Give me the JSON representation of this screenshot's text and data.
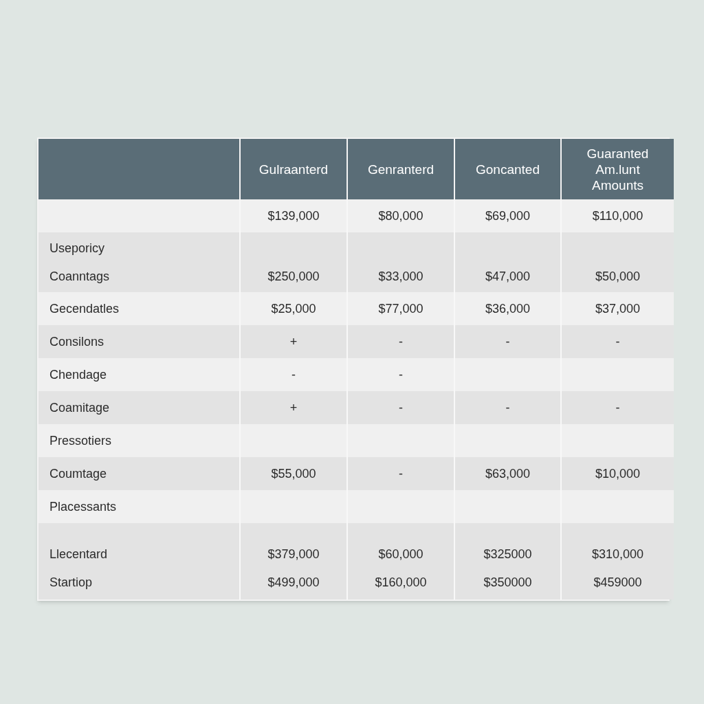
{
  "table": {
    "columns": [
      {},
      {
        "lines": [
          "Gulraanterd"
        ]
      },
      {
        "lines": [
          "Genranterd"
        ]
      },
      {
        "lines": [
          "Goncanted"
        ]
      },
      {
        "lines": [
          "Guaranted",
          "Am.lunt",
          "Amounts"
        ]
      }
    ],
    "rows": [
      {
        "lines": [
          {
            "values": [
              "$139,000",
              "$80,000",
              "$69,000",
              "$110,000"
            ]
          }
        ]
      },
      {
        "lines": [
          {
            "label": "Useporicy"
          },
          {
            "label": "Coanntags",
            "values": [
              "$250,000",
              "$33,000",
              "$47,000",
              "$50,000"
            ]
          }
        ]
      },
      {
        "lines": [
          {
            "label": "Gecendatles",
            "values": [
              "$25,000",
              "$77,000",
              "$36,000",
              "$37,000"
            ]
          }
        ]
      },
      {
        "lines": [
          {
            "label": "Consilons",
            "values": [
              "+",
              "-",
              "-",
              "-"
            ]
          }
        ]
      },
      {
        "lines": [
          {
            "label": "Chendage",
            "values": [
              "-",
              "-"
            ]
          }
        ]
      },
      {
        "lines": [
          {
            "label": "Coamitage",
            "values": [
              "+",
              "-",
              "-",
              "-"
            ]
          }
        ]
      },
      {
        "lines": [
          {
            "label": "Pressotiers"
          }
        ]
      },
      {
        "lines": [
          {
            "label": "Coumtage",
            "values": [
              "$55,000",
              "-",
              "$63,000",
              "$10,000"
            ]
          }
        ]
      },
      {
        "lines": [
          {
            "label": "Placessants"
          }
        ]
      },
      {
        "lines": [
          {
            "label": "Llecentard",
            "values": [
              "$379,000",
              "$60,000",
              "$325000",
              "$310,000"
            ]
          },
          {
            "label": "Startiop",
            "values": [
              "$499,000",
              "$160,000",
              "$350000",
              "$459000"
            ]
          }
        ]
      }
    ]
  }
}
